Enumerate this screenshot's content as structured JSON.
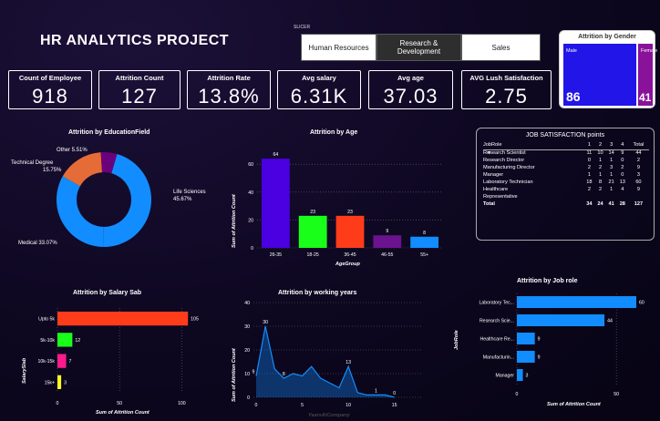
{
  "header": {
    "title": "HR ANALYTICS PROJECT"
  },
  "slicer": {
    "label": "SLICER",
    "options": [
      {
        "label": "Human Resources",
        "selected": false
      },
      {
        "label": "Research & Development",
        "selected": true
      },
      {
        "label": "Sales",
        "selected": false
      }
    ]
  },
  "kpis": [
    {
      "label": "Count of Employee",
      "value": "918"
    },
    {
      "label": "Attrition Count",
      "value": "127"
    },
    {
      "label": "Attrition Rate",
      "value": "13.8%"
    },
    {
      "label": "Avg salary",
      "value": "6.31K"
    },
    {
      "label": "Avg age",
      "value": "37.03"
    },
    {
      "label": "AVG Lush Satisfaction",
      "value": "2.75"
    }
  ],
  "gender": {
    "title": "Attrition by Gender",
    "male_label": "Male",
    "male_value": "86",
    "female_label": "Female",
    "female_value": "41",
    "colors": {
      "male": "#2115e8",
      "female": "#8a129b"
    }
  },
  "education": {
    "title": "Attrition by EducationField",
    "chart_data": {
      "type": "pie",
      "title": "Attrition by EducationField",
      "labels": [
        "Life Sciences",
        "Medical",
        "Technical Degree",
        "Other"
      ],
      "values": [
        45.67,
        33.07,
        15.75,
        5.51
      ],
      "display": [
        "Life Sciences 45.67%",
        "Medical 33.07%",
        "Technical Degree 15.75%",
        "Other 5.51%"
      ],
      "colors": [
        "#118dff",
        "#118dff",
        "#e66c37",
        "#6b007b"
      ]
    }
  },
  "age": {
    "title": "Attrition by Age",
    "chart_data": {
      "type": "bar",
      "title": "Attrition by Age",
      "categories": [
        "26-35",
        "18-25",
        "36-45",
        "46-55",
        "55+"
      ],
      "values": [
        64,
        23,
        23,
        9,
        8
      ],
      "colors": [
        "#4a00e0",
        "#1aff1a",
        "#ff3c1a",
        "#6b138f",
        "#118dff"
      ],
      "xlabel": "AgeGroup",
      "ylabel": "Sum of Attrition Count",
      "ylim": [
        0,
        60
      ],
      "yticks": [
        0,
        20,
        40,
        60
      ]
    }
  },
  "job_satisfaction": {
    "title": "JOB SATISFACTION points",
    "columns": [
      "JobRole",
      "1",
      "2",
      "3",
      "4",
      "Total"
    ],
    "rows": [
      [
        "Research Scientist",
        "11",
        "10",
        "14",
        "9",
        "44"
      ],
      [
        "Research Director",
        "0",
        "1",
        "1",
        "0",
        "2"
      ],
      [
        "Manufacturing Director",
        "2",
        "2",
        "3",
        "2",
        "9"
      ],
      [
        "Manager",
        "1",
        "1",
        "1",
        "0",
        "3"
      ],
      [
        "Laboratory Technician",
        "18",
        "8",
        "21",
        "13",
        "60"
      ],
      [
        "Healthcare",
        "2",
        "2",
        "1",
        "4",
        "9"
      ],
      [
        "Representative",
        "",
        "",
        "",
        "",
        ""
      ]
    ],
    "total": [
      "Total",
      "34",
      "24",
      "41",
      "28",
      "127"
    ]
  },
  "salary": {
    "title": "Attrition by Salary Sab",
    "chart_data": {
      "type": "bar",
      "orientation": "horizontal",
      "title": "Attrition by Salary Sab",
      "categories": [
        "Upto 5k",
        "5k-10k",
        "10k-15k",
        "15k+"
      ],
      "values": [
        105,
        12,
        7,
        3
      ],
      "colors": [
        "#ff3c1a",
        "#1aff1a",
        "#ff1a8c",
        "#ffff1a"
      ],
      "xlabel": "Sum of Attrition Count",
      "ylabel": "SalarySlab",
      "xlim": [
        0,
        110
      ],
      "xticks": [
        0,
        50,
        100
      ]
    }
  },
  "years": {
    "title": "Attrition by working years",
    "chart_data": {
      "type": "area",
      "title": "Attrition by working years",
      "x": [
        0,
        1,
        2,
        3,
        4,
        5,
        6,
        7,
        8,
        9,
        10,
        11,
        12,
        13,
        14,
        15
      ],
      "values": [
        9,
        30,
        12,
        8,
        10,
        9,
        13,
        8,
        6,
        4,
        13,
        2,
        1,
        1,
        1,
        0
      ],
      "labels_shown": {
        "0": "9",
        "1": "30",
        "3": "8",
        "10": "13",
        "13": "1",
        "15": "0"
      },
      "xlabel": "YearsAtCompany",
      "ylabel": "Sum of Attrition Count",
      "ylim": [
        0,
        40
      ],
      "yticks": [
        0,
        10,
        20,
        30,
        40
      ],
      "xticks": [
        0,
        5,
        10,
        15
      ],
      "color": "#118dff"
    }
  },
  "jobrole": {
    "title": "Attrition by Job role",
    "chart_data": {
      "type": "bar",
      "orientation": "horizontal",
      "title": "Attrition by Job role",
      "categories": [
        "Laboratory Tec...",
        "Research Scie...",
        "Healthcare Re...",
        "Manufacturin...",
        "Manager"
      ],
      "values": [
        60,
        44,
        9,
        9,
        3
      ],
      "color": "#118dff",
      "xlabel": "Sum of Attrition Count",
      "ylabel": "JobRole",
      "xlim": [
        0,
        60
      ],
      "xticks": [
        0,
        50
      ]
    }
  }
}
